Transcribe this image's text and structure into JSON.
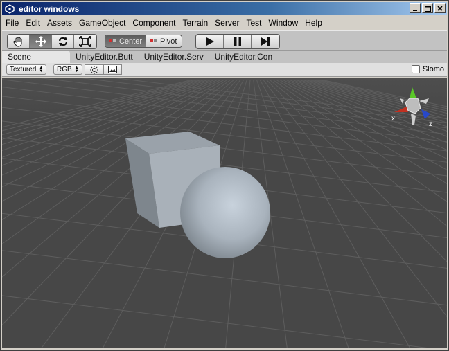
{
  "window": {
    "title": "editor windows"
  },
  "menu": {
    "items": [
      "File",
      "Edit",
      "Assets",
      "GameObject",
      "Component",
      "Terrain",
      "Server",
      "Test",
      "Window",
      "Help"
    ]
  },
  "toolbar": {
    "tools": [
      "hand-icon",
      "move-icon",
      "rotate-icon",
      "scale-icon"
    ],
    "pivot_center_label": "Center",
    "pivot_pivot_label": "Pivot"
  },
  "tabs": [
    "Scene",
    "UnityEditor.Butt",
    "UnityEditor.Serv",
    "UnityEditor.Con"
  ],
  "scene_toolbar": {
    "render_mode": "Textured",
    "channel": "RGB",
    "slomo_label": "Slomo"
  },
  "gizmo": {
    "x_label": "x",
    "z_label": "z"
  },
  "colors": {
    "titlebar_start": "#0a246a",
    "viewport_bg": "#474747",
    "grid": "#5a5a5a"
  }
}
